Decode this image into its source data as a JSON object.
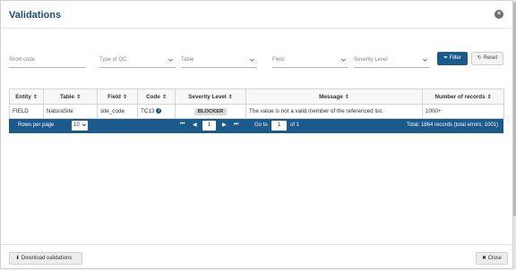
{
  "modal": {
    "title": "Validations"
  },
  "filters": {
    "short_code": "Short code",
    "type_of_qc": "Type of QC",
    "table": "Table",
    "field": "Field",
    "severity_level": "Severity Level",
    "filter_button": "Filter",
    "reset_button": "Reset"
  },
  "table": {
    "headers": [
      "Entity",
      "Table",
      "Field",
      "Code",
      "Severity Level",
      "Message",
      "Number of records"
    ],
    "rows": [
      [
        "FIELD",
        "NaturaSite",
        "site_code",
        "TC13",
        "BLOCKER",
        "The value is not a valid member of the referenced list.",
        "1000+"
      ]
    ]
  },
  "pagination": {
    "rows_per_page_label": "Rows per page",
    "rows_per_page": "10",
    "current_page": "1",
    "goto_label": "Go to",
    "goto_value": "1",
    "of_label": "of 1",
    "total_text": "Total: 1864 records (total errors: 1001)"
  },
  "footer": {
    "download_label": "Download validations",
    "close_label": "Close"
  },
  "colors": {
    "primary": "#1a5a8c",
    "title": "#1a4d7a"
  }
}
